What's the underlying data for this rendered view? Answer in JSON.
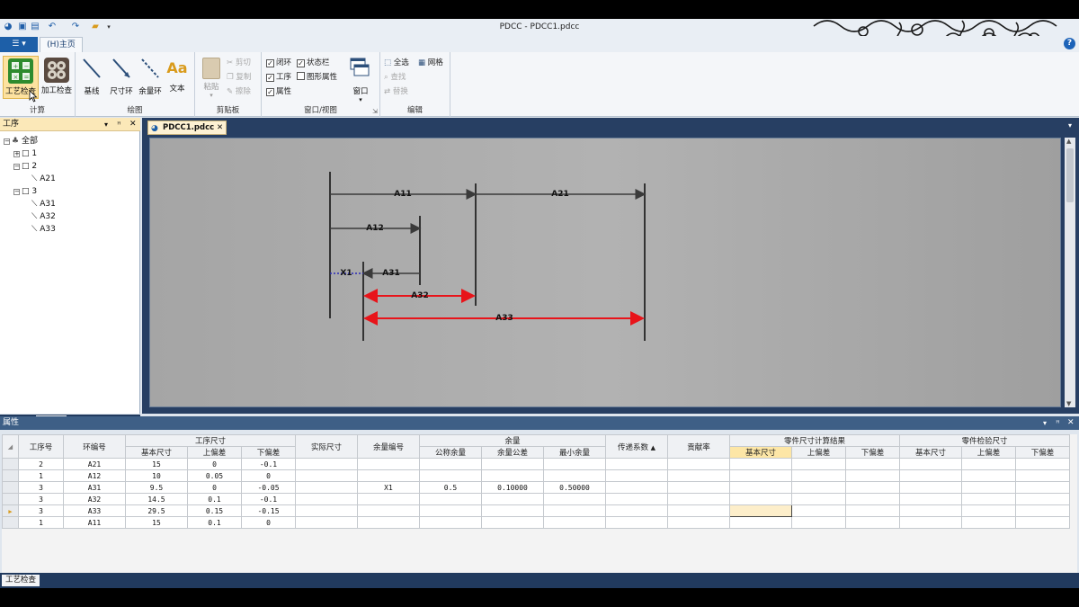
{
  "window": {
    "title": "PDCC - PDCC1.pdcc"
  },
  "ribbon": {
    "app_button": "",
    "home_tab": "(H)主页",
    "groups": {
      "calc": {
        "label": "计算",
        "process_check": "工艺检查",
        "machining_check": "加工检查"
      },
      "draw": {
        "label": "绘图",
        "baseline": "基线",
        "dim_chain": "尺寸环",
        "allowance_chain": "余量环",
        "text": "文本"
      },
      "clipboard": {
        "label": "剪贴板",
        "paste": "粘贴",
        "cut": "剪切",
        "copy": "复制",
        "erase": "擦除"
      },
      "window_view": {
        "label": "窗口/视图",
        "closed_loop": "闭环",
        "status_bar": "状态栏",
        "process": "工序",
        "shape_props": "图形属性",
        "properties": "属性",
        "window": "窗口"
      },
      "edit": {
        "label": "编辑",
        "select_all": "全选",
        "grid": "网格",
        "find": "查找",
        "replace": "替换"
      }
    }
  },
  "tree": {
    "title": "工序",
    "nodes": [
      {
        "label": "全部",
        "level": 0
      },
      {
        "label": "1",
        "level": 1
      },
      {
        "label": "2",
        "level": 1
      },
      {
        "label": "A21",
        "level": 2
      },
      {
        "label": "3",
        "level": 1
      },
      {
        "label": "A31",
        "level": 2
      },
      {
        "label": "A32",
        "level": 2
      },
      {
        "label": "A33",
        "level": 2
      }
    ],
    "tabs": [
      "闭环",
      "工序"
    ]
  },
  "document": {
    "tab": "PDCC1.pdcc"
  },
  "diagram": {
    "labels": {
      "a11": "A11",
      "a21": "A21",
      "a12": "A12",
      "a31": "A31",
      "x1": "X1",
      "a32": "A32",
      "a33": "A33"
    },
    "colors": {
      "normal": "#333333",
      "red": "#e8141a",
      "blue": "#2a2ab8"
    }
  },
  "properties": {
    "title": "属性",
    "headers": {
      "proc_no": "工序号",
      "ring_no": "环编号",
      "proc_dim": "工序尺寸",
      "basic": "基本尺寸",
      "upper": "上偏差",
      "lower": "下偏差",
      "actual": "实际尺寸",
      "allow_no": "余量编号",
      "allowance": "余量",
      "nominal_allow": "公称余量",
      "allow_tol": "余量公差",
      "min_allow": "最小余量",
      "transfer": "传递系数",
      "contrib": "贡献率",
      "part_calc": "零件尺寸计算结果",
      "part_basic": "基本尺寸",
      "part_upper": "上偏差",
      "part_lower": "下偏差",
      "inspect": "零件检验尺寸",
      "ins_basic": "基本尺寸",
      "ins_upper": "上偏差",
      "ins_lower": "下偏差"
    },
    "rows": [
      {
        "proc": "2",
        "ring": "A21",
        "basic": "15",
        "upper": "0",
        "lower": "-0.1",
        "allow_no": "",
        "nominal": "",
        "tol": "",
        "min": ""
      },
      {
        "proc": "1",
        "ring": "A12",
        "basic": "10",
        "upper": "0.05",
        "lower": "0",
        "allow_no": "",
        "nominal": "",
        "tol": "",
        "min": ""
      },
      {
        "proc": "3",
        "ring": "A31",
        "basic": "9.5",
        "upper": "0",
        "lower": "-0.05",
        "allow_no": "X1",
        "nominal": "0.5",
        "tol": "0.10000",
        "min": "0.50000"
      },
      {
        "proc": "3",
        "ring": "A32",
        "basic": "14.5",
        "upper": "0.1",
        "lower": "-0.1",
        "allow_no": "",
        "nominal": "",
        "tol": "",
        "min": ""
      },
      {
        "proc": "3",
        "ring": "A33",
        "basic": "29.5",
        "upper": "0.15",
        "lower": "-0.15",
        "allow_no": "",
        "nominal": "",
        "tol": "",
        "min": ""
      },
      {
        "proc": "1",
        "ring": "A11",
        "basic": "15",
        "upper": "0.1",
        "lower": "0",
        "allow_no": "",
        "nominal": "",
        "tol": "",
        "min": ""
      }
    ]
  },
  "statusbar": {
    "tab": "工艺检查"
  }
}
